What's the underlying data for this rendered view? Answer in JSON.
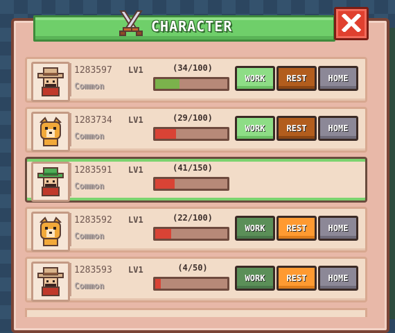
{
  "header": {
    "title": "CHARACTER"
  },
  "rows": [
    {
      "id": "1283597",
      "level": "LV1",
      "rarity": "Common",
      "hp": "(34/100)",
      "hp_fraction": 0.34,
      "bar_color": "#7bb24c",
      "avatar": "cowboy",
      "work_style": "light",
      "rest_style": "dark",
      "work": "WORK",
      "rest": "REST",
      "home": "HOME"
    },
    {
      "id": "1283734",
      "level": "LV1",
      "rarity": "Common",
      "hp": "(29/100)",
      "hp_fraction": 0.29,
      "bar_color": "#d94335",
      "avatar": "dog",
      "work_style": "light",
      "rest_style": "dark",
      "work": "WORK",
      "rest": "REST",
      "home": "HOME"
    },
    {
      "id": "1283591",
      "level": "LV1",
      "rarity": "Common",
      "hp": "(41/150)",
      "hp_fraction": 0.27,
      "bar_color": "#d94335",
      "avatar": "green-hat",
      "selected": true
    },
    {
      "id": "1283592",
      "level": "LV1",
      "rarity": "Common",
      "hp": "(22/100)",
      "hp_fraction": 0.22,
      "bar_color": "#d94335",
      "avatar": "dog",
      "work_style": "dark",
      "rest_style": "bright",
      "work": "WORK",
      "rest": "REST",
      "home": "HOME"
    },
    {
      "id": "1283593",
      "level": "LV1",
      "rarity": "Common",
      "hp": "(4/50)",
      "hp_fraction": 0.08,
      "bar_color": "#d94335",
      "avatar": "cowboy",
      "work_style": "dark",
      "rest_style": "bright",
      "work": "WORK",
      "rest": "REST",
      "home": "HOME"
    }
  ],
  "colors": {
    "header_green": "#6fcf6a",
    "close_red": "#e0402f",
    "panel": "#e8b8a8"
  },
  "icons": {
    "header": "crossed-swords-icon",
    "close": "close-icon"
  }
}
